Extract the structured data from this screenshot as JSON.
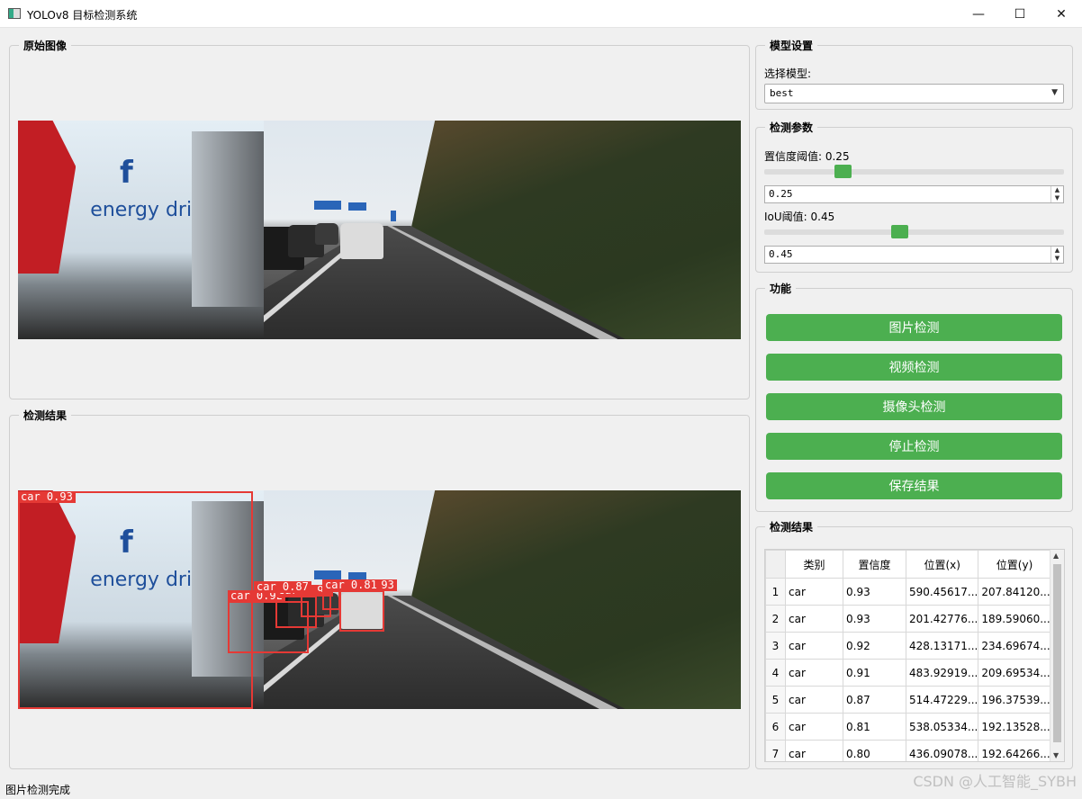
{
  "window": {
    "title": "YOLOv8 目标检测系统",
    "minimize": "—",
    "maximize": "☐",
    "close": "✕"
  },
  "panels": {
    "original_title": "原始图像",
    "result_title": "检测结果",
    "model_title": "模型设置",
    "params_title": "检测参数",
    "function_title": "功能",
    "table_title": "检测结果"
  },
  "image": {
    "brand_text": "energy drink",
    "logo_letter": "f"
  },
  "detections": [
    {
      "label": "car 0.93"
    },
    {
      "label": "car 0.93"
    },
    {
      "label": "car 0.92"
    },
    {
      "label": "car 0.91"
    },
    {
      "label": "car 0.87"
    },
    {
      "label": "car 0.81"
    }
  ],
  "model": {
    "select_label": "选择模型:",
    "selected": "best",
    "dropdown_icon": "chevron-down-icon"
  },
  "params": {
    "conf_label": "置信度阈值: 0.25",
    "conf_value": "0.25",
    "conf_level": 0.25,
    "iou_label": "IoU阈值: 0.45",
    "iou_value": "0.45",
    "iou_level": 0.45,
    "accent_color": "#4caf50"
  },
  "functions": {
    "image_detect": "图片检测",
    "video_detect": "视频检测",
    "camera_detect": "摄像头检测",
    "stop_detect": "停止检测",
    "save_result": "保存结果"
  },
  "table": {
    "headers": [
      "类别",
      "置信度",
      "位置(x)",
      "位置(y)"
    ],
    "rows": [
      [
        "1",
        "car",
        "0.93",
        "590.45617...",
        "207.84120..."
      ],
      [
        "2",
        "car",
        "0.93",
        "201.42776...",
        "189.59060..."
      ],
      [
        "3",
        "car",
        "0.92",
        "428.13171...",
        "234.69674..."
      ],
      [
        "4",
        "car",
        "0.91",
        "483.92919...",
        "209.69534..."
      ],
      [
        "5",
        "car",
        "0.87",
        "514.47229...",
        "196.37539..."
      ],
      [
        "6",
        "car",
        "0.81",
        "538.05334...",
        "192.13528..."
      ],
      [
        "7",
        "car",
        "0.80",
        "436.09078...",
        "192.64266..."
      ]
    ]
  },
  "status": {
    "text": "图片检测完成",
    "watermark": "CSDN @人工智能_SYBH"
  },
  "colors": {
    "button_green": "#4caf50",
    "detection_red": "#e53935"
  }
}
